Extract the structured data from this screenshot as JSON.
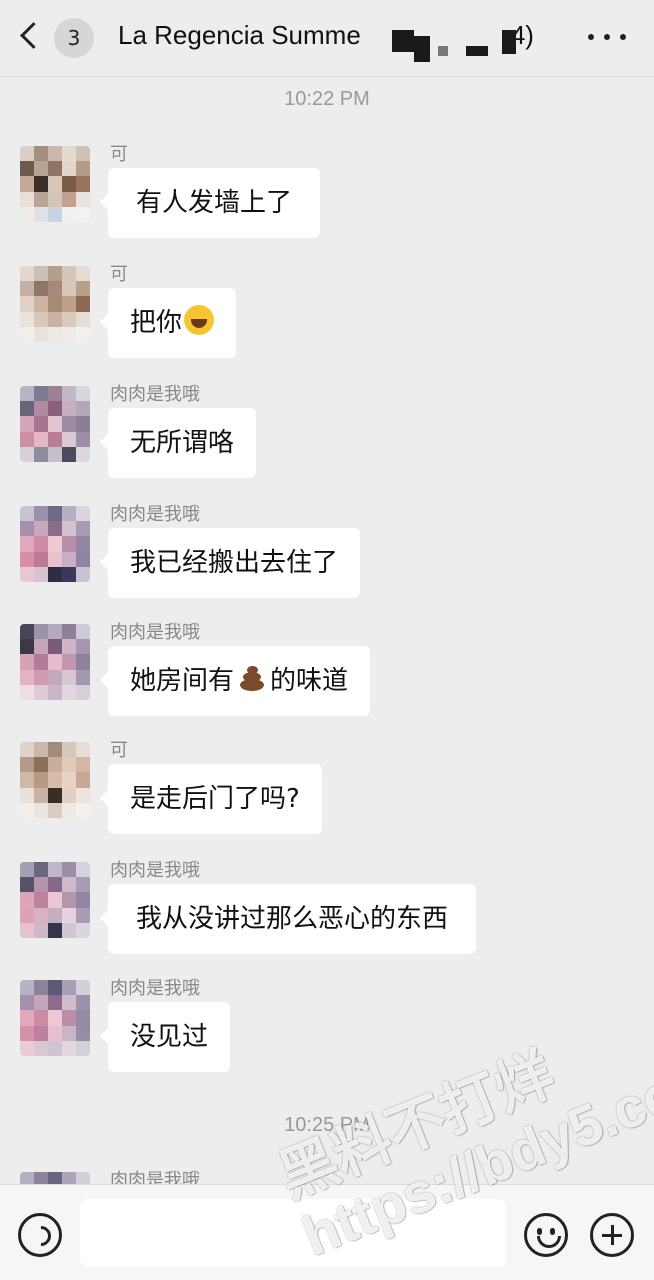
{
  "header": {
    "unread_count": "3",
    "title_visible": "La Regencia Summe",
    "title_suffix": "4)"
  },
  "messages": [
    {
      "sender": "可",
      "text": "有人发墙上了"
    },
    {
      "sender": "可",
      "text": "把你"
    },
    {
      "sender": "肉肉是我哦",
      "text": "无所谓咯"
    },
    {
      "sender": "肉肉是我哦",
      "text": "我已经搬出去住了"
    },
    {
      "sender": "肉肉是我哦",
      "text_before": "她房间有",
      "text_after": "的味道"
    },
    {
      "sender": "可",
      "text": "是走后门了吗?"
    },
    {
      "sender": "肉肉是我哦",
      "text": "我从没讲过那么恶心的东西"
    },
    {
      "sender": "肉肉是我哦",
      "text": "没见过"
    },
    {
      "sender": "肉肉是我哦"
    }
  ],
  "timestamps": [
    "10:22 PM",
    "10:25 PM"
  ],
  "composer": {
    "input_value": ""
  },
  "watermark": {
    "line1": "黑料不打烊",
    "line2": "https://bdy5.co"
  },
  "icons": {
    "back": "chevron-left-icon",
    "more": "more-dots-icon",
    "voice": "voice-icon",
    "emoji": "smiley-icon",
    "plus": "plus-circle-icon",
    "laugh": "tears-of-joy-emoji",
    "poop": "poop-emoji"
  },
  "colors": {
    "background": "#ededed",
    "bubble": "#ffffff",
    "sender_text": "#888888",
    "timestamp_text": "#9a9a9a"
  }
}
